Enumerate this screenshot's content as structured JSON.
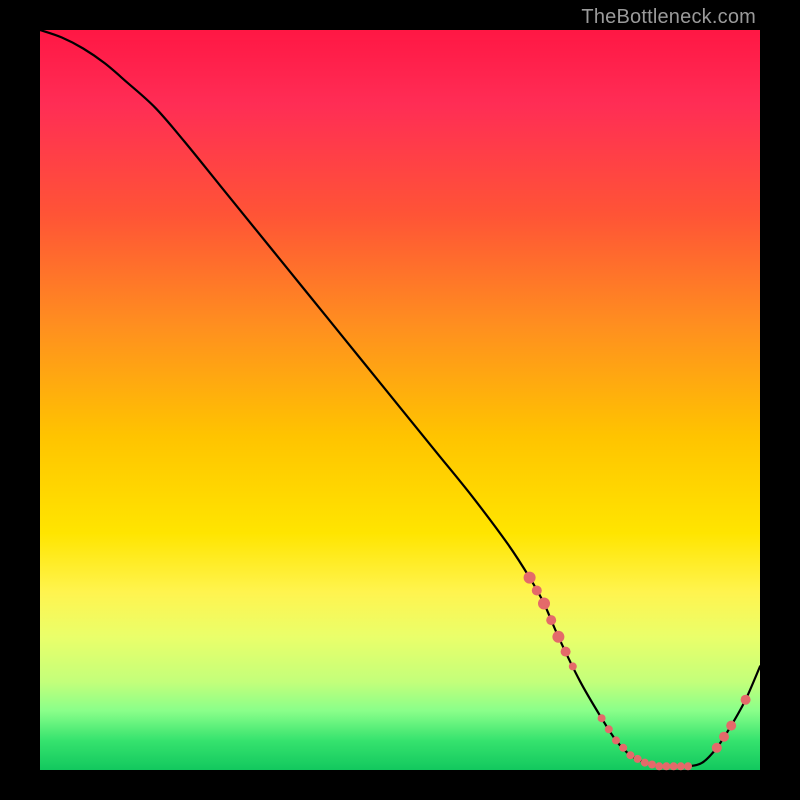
{
  "watermark": "TheBottleneck.com",
  "colors": {
    "background": "#000000",
    "marker": "#e46a6a",
    "line": "#000000"
  },
  "chart_data": {
    "type": "line",
    "title": "",
    "xlabel": "",
    "ylabel": "",
    "xlim": [
      0,
      100
    ],
    "ylim": [
      0,
      100
    ],
    "series": [
      {
        "name": "bottleneck-curve",
        "x": [
          0,
          3,
          6,
          9,
          12,
          16,
          20,
          25,
          30,
          35,
          40,
          45,
          50,
          55,
          60,
          65,
          68,
          70,
          72,
          75,
          78,
          80,
          82,
          84,
          86,
          88,
          90,
          92,
          94,
          96,
          98,
          100
        ],
        "y": [
          100,
          99,
          97.5,
          95.5,
          93,
          89.5,
          85,
          79,
          73,
          67,
          61,
          55,
          49,
          43,
          37,
          30.5,
          26,
          22.5,
          18,
          12,
          7,
          4,
          2,
          1,
          0.5,
          0.5,
          0.5,
          1,
          3,
          6,
          9.5,
          14
        ]
      }
    ],
    "markers": {
      "name": "highlight-points",
      "points": [
        {
          "x": 68,
          "size": 6
        },
        {
          "x": 69,
          "size": 5
        },
        {
          "x": 70,
          "size": 6
        },
        {
          "x": 71,
          "size": 5
        },
        {
          "x": 72,
          "size": 6
        },
        {
          "x": 73,
          "size": 5
        },
        {
          "x": 74,
          "size": 4
        },
        {
          "x": 78,
          "size": 4
        },
        {
          "x": 79,
          "size": 4
        },
        {
          "x": 80,
          "size": 4
        },
        {
          "x": 81,
          "size": 4
        },
        {
          "x": 82,
          "size": 4
        },
        {
          "x": 83,
          "size": 4
        },
        {
          "x": 84,
          "size": 4
        },
        {
          "x": 85,
          "size": 4
        },
        {
          "x": 86,
          "size": 4
        },
        {
          "x": 87,
          "size": 4
        },
        {
          "x": 88,
          "size": 4
        },
        {
          "x": 89,
          "size": 4
        },
        {
          "x": 90,
          "size": 4
        },
        {
          "x": 94,
          "size": 5
        },
        {
          "x": 95,
          "size": 5
        },
        {
          "x": 96,
          "size": 5
        },
        {
          "x": 98,
          "size": 5
        }
      ]
    }
  }
}
